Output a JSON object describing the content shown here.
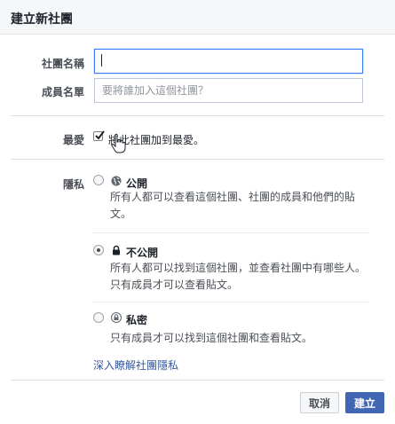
{
  "dialog": {
    "title": "建立新社團"
  },
  "form": {
    "group_name_label": "社團名稱",
    "group_name_value": "",
    "members_label": "成員名單",
    "members_placeholder": "要將誰加入這個社團？"
  },
  "favorite": {
    "label": "最愛",
    "checkbox_label": "將此社團加到最愛。",
    "checked": true
  },
  "privacy": {
    "label": "隱私",
    "selected": "closed",
    "options": [
      {
        "id": "public",
        "icon": "globe-icon",
        "title": "公開",
        "description": "所有人都可以查看這個社團、社團的成員和他們的貼文。"
      },
      {
        "id": "closed",
        "icon": "lock-icon",
        "title": "不公開",
        "description": "所有人都可以找到這個社團，並查看社團中有哪些人。只有成員才可以查看貼文。"
      },
      {
        "id": "secret",
        "icon": "secret-lock-icon",
        "title": "私密",
        "description": "只有成員才可以找到這個社團和查看貼文。"
      }
    ],
    "learn_more_link": "深入瞭解社團隱私"
  },
  "footer": {
    "cancel_label": "取消",
    "create_label": "建立"
  },
  "colors": {
    "header_bg": "#f6f7f9",
    "primary": "#4267b2",
    "link": "#365899",
    "focus_border": "#4080ff"
  }
}
